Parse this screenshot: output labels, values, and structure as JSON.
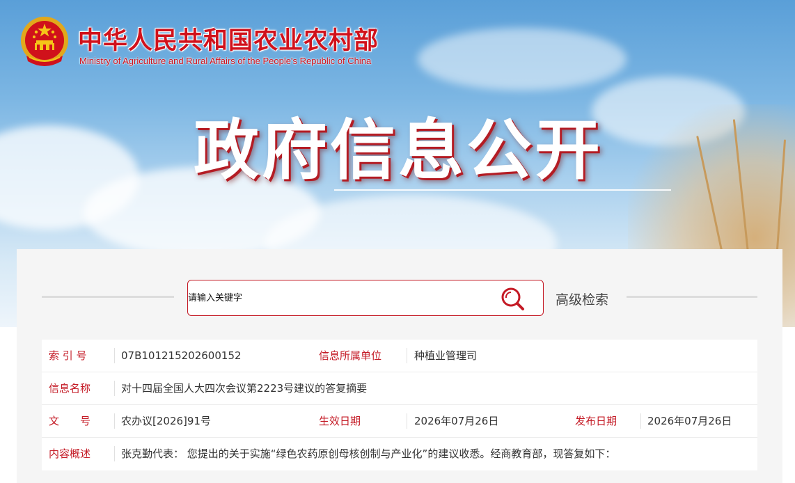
{
  "header": {
    "ministry_cn": "中华人民共和国农业农村部",
    "ministry_en": "Ministry of Agriculture and Rural Affairs of the People's Republic of China",
    "section_title": "政府信息公开"
  },
  "search": {
    "placeholder": "请输入关键字",
    "advanced_label": "高级检索"
  },
  "info": {
    "index_label": "索 引 号",
    "index_value": "07B101215202600152",
    "unit_label": "信息所属单位",
    "unit_value": "种植业管理司",
    "name_label": "信息名称",
    "name_value": "对十四届全国人大四次会议第2223号建议的答复摘要",
    "doc_label": "文　　号",
    "doc_value": "农办议[2026]91号",
    "effective_label": "生效日期",
    "effective_value": "2026年07月26日",
    "publish_label": "发布日期",
    "publish_value": "2026年07月26日",
    "summary_label": "内容概述",
    "summary_value": "张克勤代表：  您提出的关于实施“绿色农药原创母核创制与产业化”的建议收悉。经商教育部，现答复如下："
  },
  "colors": {
    "accent": "#c41a25",
    "label_text": "#c41a25",
    "body_text": "#333333"
  },
  "icons": [
    "national-emblem-icon",
    "search-icon"
  ]
}
